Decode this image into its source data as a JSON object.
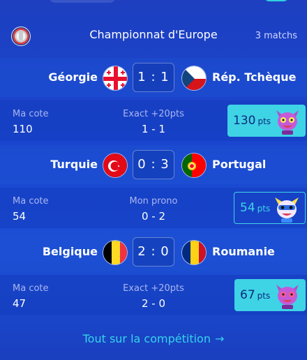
{
  "competition": {
    "title": "Championnat d'Europe",
    "count": "3 matchs",
    "icon": "trophy-icon"
  },
  "matches": [
    {
      "home": "Géorgie",
      "away": "Rép. Tchèque",
      "score": "1 : 1",
      "home_flag": "georgia-flag-icon",
      "away_flag": "czech-flag-icon",
      "left_label": "Ma cote",
      "left_value": "110",
      "center_label": "Exact +20pts",
      "center_value": "1 - 1",
      "points": "130",
      "points_unit": "pts",
      "points_style": "filled"
    },
    {
      "home": "Turquie",
      "away": "Portugal",
      "score": "0 : 3",
      "home_flag": "turkey-flag-icon",
      "away_flag": "portugal-flag-icon",
      "left_label": "Ma cote",
      "left_value": "54",
      "center_label": "Mon prono",
      "center_value": "0 - 2",
      "points": "54",
      "points_unit": "pts",
      "points_style": "outline"
    },
    {
      "home": "Belgique",
      "away": "Roumanie",
      "score": "2 : 0",
      "home_flag": "belgium-flag-icon",
      "away_flag": "romania-flag-icon",
      "left_label": "Ma cote",
      "left_value": "47",
      "center_label": "Exact +20pts",
      "center_value": "2 - 0",
      "points": "67",
      "points_unit": "pts",
      "points_style": "filled"
    }
  ],
  "footer": {
    "link_label": "Tout sur la compétition",
    "arrow": "→"
  },
  "colors": {
    "accent": "#3fd3e6",
    "background": "#1b46cf"
  }
}
